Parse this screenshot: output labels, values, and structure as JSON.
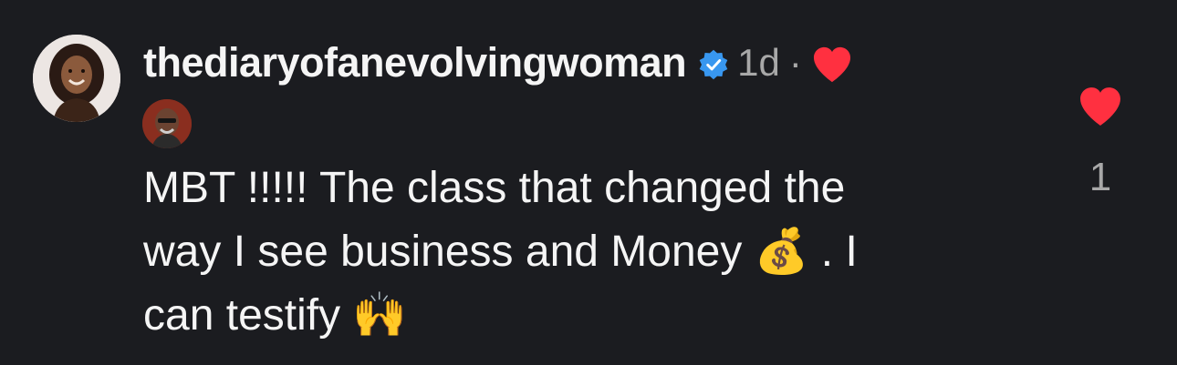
{
  "comment": {
    "username": "thediaryofanevolvingwoman",
    "time": "1d",
    "separator": "·",
    "text": "MBT !!!!! The class that changed the\nway I see business and Money 💰 . I\ncan testify 🙌",
    "like_count": "1"
  },
  "colors": {
    "background": "#1b1c20",
    "heart": "#ff3040",
    "verified": "#3897f0",
    "muted": "#a8a8a8"
  },
  "icons": {
    "verified": "verified-badge-icon",
    "creator_liked": "heart-icon",
    "like": "heart-icon"
  }
}
